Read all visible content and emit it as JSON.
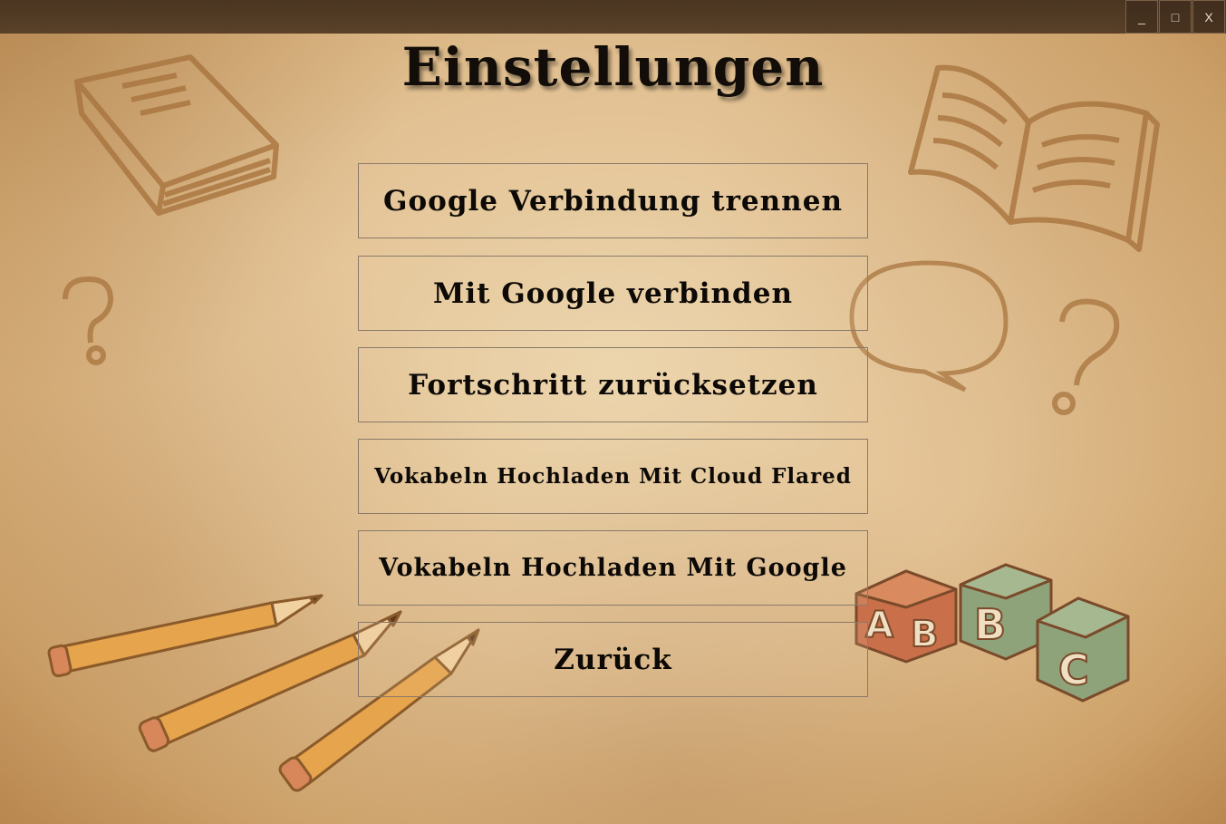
{
  "window": {
    "minimize_label": "_",
    "maximize_label": "□",
    "close_label": "X"
  },
  "page": {
    "title": "Einstellungen"
  },
  "menu": {
    "disconnect_google": "Google Verbindung trennen",
    "connect_google": "Mit Google verbinden",
    "reset_progress": "Fortschritt zurücksetzen",
    "upload_cloudflared": "Vokabeln Hochladen Mit Cloud Flared",
    "upload_google": "Vokabeln Hochladen Mit Google",
    "back": "Zurück"
  },
  "decorations": {
    "blocks": [
      "A",
      "B",
      "B",
      "C"
    ],
    "question_mark": "?"
  },
  "colors": {
    "parchment": "#e2c193",
    "titlebar": "#4a3522",
    "text": "#120d08",
    "block_red": "#c9704a",
    "block_green": "#8fa37a",
    "pencil": "#e6a44c"
  }
}
